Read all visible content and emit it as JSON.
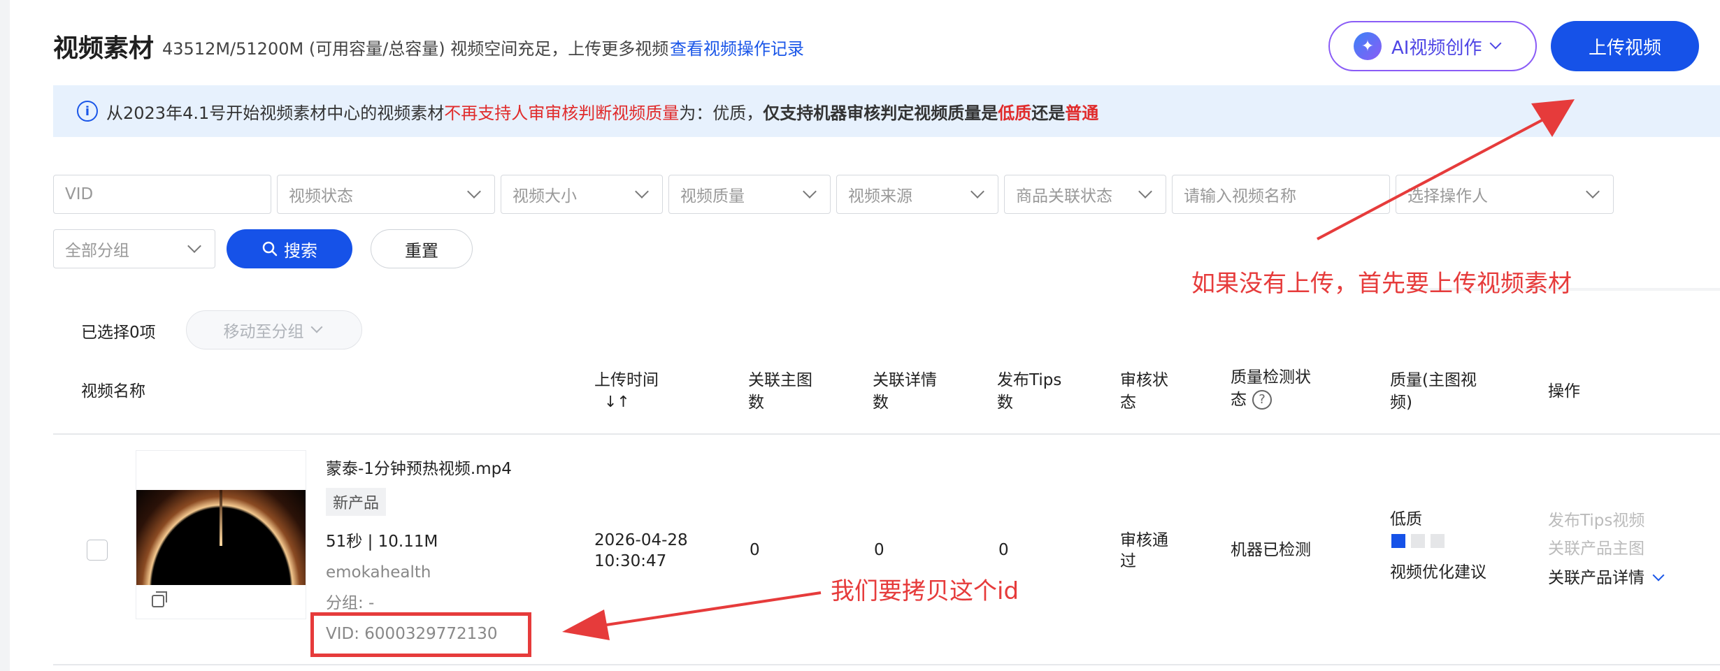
{
  "header": {
    "title": "视频素材",
    "capacity_text": "43512M/51200M (可用容量/总容量) 视频空间充足，上传更多视频",
    "op_log_link": "查看视频操作记录",
    "ai_button_label": "AI视频创作",
    "upload_button_label": "上传视频"
  },
  "notice": {
    "part1": "从2023年4.1号开始视频素材中心的视频素材",
    "part2_red": "不再支持人审审核判断视频质量",
    "part3": "为：优质，",
    "part4_bold": "仅支持机器审核判定视频质量是",
    "part5_red": "低质",
    "part6_bold": "还是",
    "part7_red": "普通"
  },
  "filters": {
    "vid_placeholder": "VID",
    "video_status": "视频状态",
    "video_size": "视频大小",
    "video_quality": "视频质量",
    "video_source": "视频来源",
    "product_link_status": "商品关联状态",
    "video_name_placeholder": "请输入视频名称",
    "operator": "选择操作人",
    "group": "全部分组",
    "search_label": "搜索",
    "reset_label": "重置"
  },
  "selection": {
    "selected_text": "已选择0项",
    "move_group_label": "移动至分组"
  },
  "table": {
    "headers": {
      "name": "视频名称",
      "upload_time_l1": "上传时间",
      "main_img_l1": "关联主图",
      "main_img_l2": "数",
      "detail_l1": "关联详情",
      "detail_l2": "数",
      "tips_l1": "发布Tips",
      "tips_l2": "数",
      "review_l1": "审核状",
      "review_l2": "态",
      "qc_l1": "质量检测状",
      "qc_l2": "态",
      "quality_l1": "质量(主图视",
      "quality_l2": "频)",
      "actions": "操作"
    },
    "row": {
      "filename": "蒙泰-1分钟预热视频.mp4",
      "tag": "新产品",
      "duration_size": "51秒 | 10.11M",
      "account": "emokahealth",
      "group": "分组: -",
      "vid": "VID: 6000329772130",
      "upload_date": "2026-04-28",
      "upload_time": "10:30:47",
      "main_img_count": "0",
      "detail_count": "0",
      "tips_count": "0",
      "review_l1": "审核通",
      "review_l2": "过",
      "qc_status": "机器已检测",
      "quality_label": "低质",
      "quality_level": 1,
      "quality_levels_total": 3,
      "optimize_link": "视频优化建议",
      "action_tips": "发布Tips视频",
      "action_main": "关联产品主图",
      "action_detail": "关联产品详情"
    }
  },
  "annotations": {
    "upload_hint": "如果没有上传，首先要上传视频素材",
    "copy_id_hint": "我们要拷贝这个id"
  },
  "colors": {
    "primary": "#1652e8",
    "annotation": "#e63b3b",
    "notice_bg": "#e7f1fd"
  }
}
